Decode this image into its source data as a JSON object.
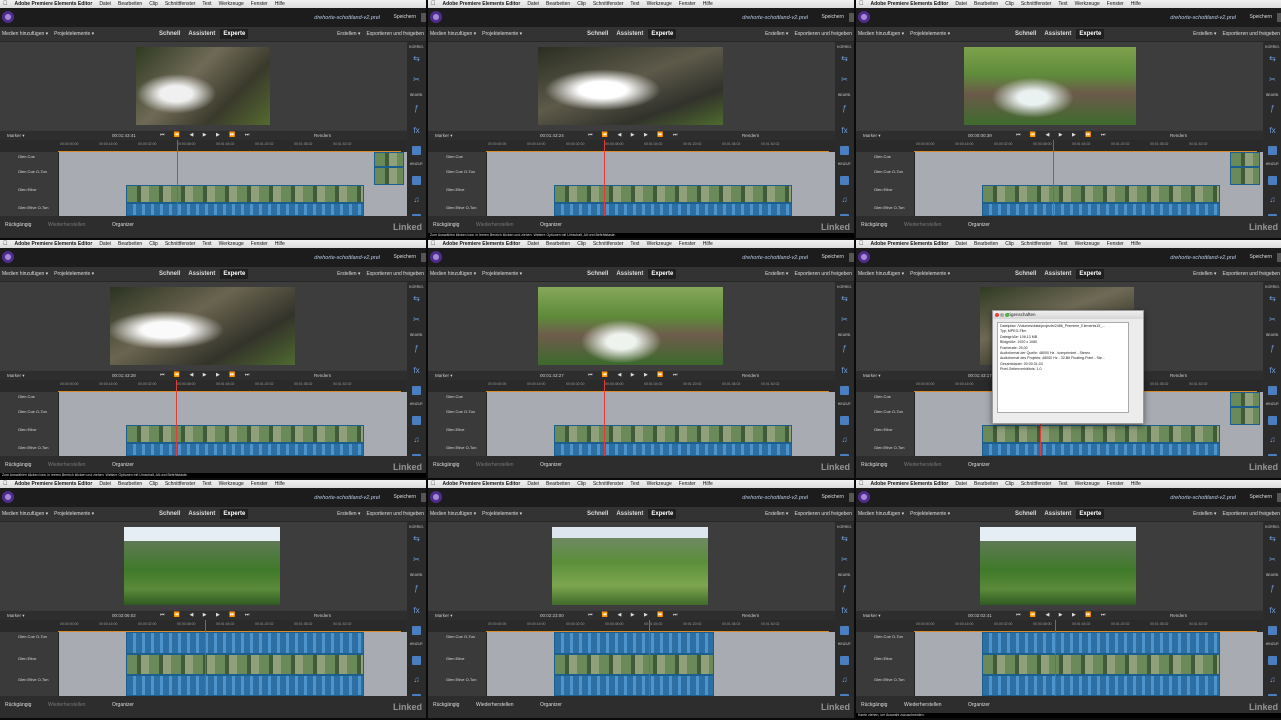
{
  "menu": {
    "apple": "",
    "app": "Adobe Premiere Elements Editor",
    "items": [
      "Datei",
      "Bearbeiten",
      "Clip",
      "Schnittfenster",
      "Text",
      "Werkzeuge",
      "Fenster",
      "Hilfe"
    ]
  },
  "titlebar": {
    "project_a": "drehorte-schottland-v2.prel",
    "project_b": "drehorte-schottland-v2.prel",
    "save": "Speichern"
  },
  "toolbar": {
    "media": "Medien hinzufügen ▾",
    "project_elements": "Projektelemente ▾",
    "modes": [
      "Schnell",
      "Assistent",
      "Experte"
    ],
    "create": "Erstellen ▾",
    "export": "Exportieren und freigeben"
  },
  "side_panel": {
    "correct": "KORRIG.",
    "effects": "BEARB.",
    "add": "HINZUF."
  },
  "timeline": {
    "marker": "Marker ▾",
    "render": "Rendern",
    "ruler_ticks": [
      "00:00:00:00",
      "00:00:16:00",
      "00:00:32:00",
      "00:00:48:00",
      "00:01:04:02",
      "00:01:20:02",
      "00:01:36:02",
      "00:01:52:02"
    ],
    "track_names": [
      "Glen Coe",
      "Glen Coe O-Ton",
      "Glen Etive",
      "Glen Etive O-Ton"
    ],
    "track_names_b": [
      "Glen Coe O-Ton",
      "Glen Etive",
      "Glen Etive O-Ton"
    ]
  },
  "panels": [
    {
      "timecode": "00:01:43:41",
      "mode": "Experte"
    },
    {
      "timecode": "00:01:43:24",
      "mode": "Experte"
    },
    {
      "timecode": "00:00:00:39",
      "mode": "Experte"
    },
    {
      "timecode": "00:01:43:28",
      "mode": "Experte"
    },
    {
      "timecode": "00:01:43:27",
      "mode": "Experte"
    },
    {
      "timecode": "00:01:43:17",
      "mode": "Experte"
    },
    {
      "timecode": "00:02:06:02",
      "mode": "Experte"
    },
    {
      "timecode": "00:02:23:00",
      "mode": "Experte"
    },
    {
      "timecode": "00:02:02:41",
      "mode": "Experte"
    }
  ],
  "clip_labels": [
    "Glen_Etive.MTS",
    "DSC_00213.MP4",
    "Glen_Etive_O-Ton.MTS",
    "Text"
  ],
  "bottom": {
    "undo": "Rückgängig",
    "redo": "Wiederherstellen",
    "organizer": "Organizer"
  },
  "captions": {
    "c2": "Zum Auswählen klicken bzw. in leeren Bereich klicken und ziehen. Weitere Optionen mit Umschalt, Alt und Befehlstaste.",
    "c4": "Zum Auswählen klicken bzw. in leeren Bereich klicken und ziehen. Weitere Optionen mit Umschalt, Alt und Befehlstaste.",
    "c9": "Kante ziehen, um Auswahl zuzuschneiden."
  },
  "properties_dialog": {
    "title": "Eigenschaften",
    "lines": [
      "Dateipfad: /Volumes/data/projects/2486_Premiere_Elements15_...",
      "Typ: MPEG-Film",
      "Dateigröße: 106,13 MB",
      "Bildgröße: 1920 x 1080",
      "Framerate: 25,00",
      "Audioformat der Quelle: 48000 Hz - komprimiert - Stereo",
      "Audioformat des Projekts: 48000 Hz - 32-Bit Floating-Point - Ste...",
      "Gesamtdauer: 00:00:31:03",
      "Pixel-Seitenverhältnis: 1,0"
    ]
  },
  "watermark": "Linked",
  "colors": {
    "accent": "#3b8fc7",
    "playhead": "#e23b3b",
    "timeline_orange": "#d78b2a",
    "selected_mode": "#1f1f1f"
  }
}
